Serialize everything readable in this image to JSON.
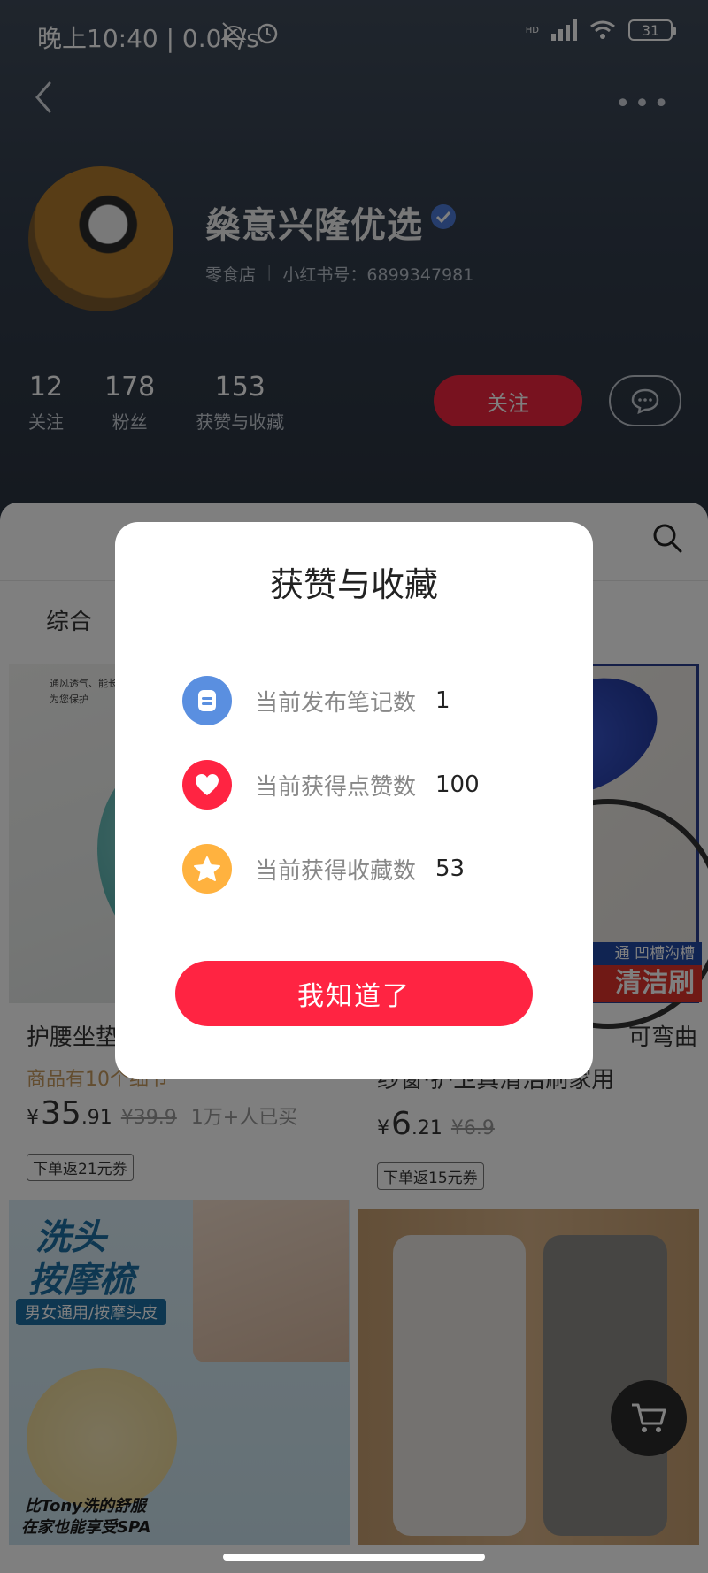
{
  "status_bar": {
    "time": "晚上10:40 | 0.0K/s",
    "network_label": "HD",
    "battery": "31"
  },
  "profile": {
    "shop_name": "燊意兴隆优选",
    "category": "零食店",
    "account_label": "小红书号：6899347981",
    "stats": [
      {
        "value": "12",
        "label": "关注"
      },
      {
        "value": "178",
        "label": "粉丝"
      },
      {
        "value": "153",
        "label": "获赞与收藏"
      }
    ],
    "follow_label": "关注"
  },
  "feed": {
    "tab_all": "综合",
    "cards": [
      {
        "title": "护腰坐垫",
        "subtitle": "商品有10个细节",
        "price_symbol": "¥",
        "price_int": "35",
        "price_dec": ".91",
        "original_price": "¥39.9",
        "sold": "1万+人已买",
        "coupon": "下单返21元券",
        "image_text": "通风透气、能长时间为您保护"
      },
      {
        "title_line1": "可弯曲",
        "title_line2": "纱窗·护卫真清洁刷家用",
        "price_symbol": "¥",
        "price_int": "6",
        "price_dec": ".21",
        "original_price": "¥6.9",
        "coupon": "下单返15元券",
        "image_banner": "通 凹槽沟槽",
        "image_banner_big": "清洁刷"
      },
      {
        "image_title_1": "洗头",
        "image_title_2": "按摩梳",
        "image_tag": "男女通用/按摩头皮",
        "image_footer_1": "比Tony洗的舒服",
        "image_footer_2": "在家也能享受SPA"
      },
      {}
    ]
  },
  "dialog": {
    "title": "获赞与收藏",
    "rows": [
      {
        "icon": "note-icon",
        "label": "当前发布笔记数",
        "value": "1",
        "color": "#5a8fe0"
      },
      {
        "icon": "heart-icon",
        "label": "当前获得点赞数",
        "value": "100",
        "color": "#ff2442"
      },
      {
        "icon": "star-icon",
        "label": "当前获得收藏数",
        "value": "53",
        "color": "#ffb23f"
      }
    ],
    "button_label": "我知道了"
  },
  "colors": {
    "accent": "#ff2442",
    "header_bg": "#323d4c",
    "coupon_text": "#c79a5e"
  }
}
